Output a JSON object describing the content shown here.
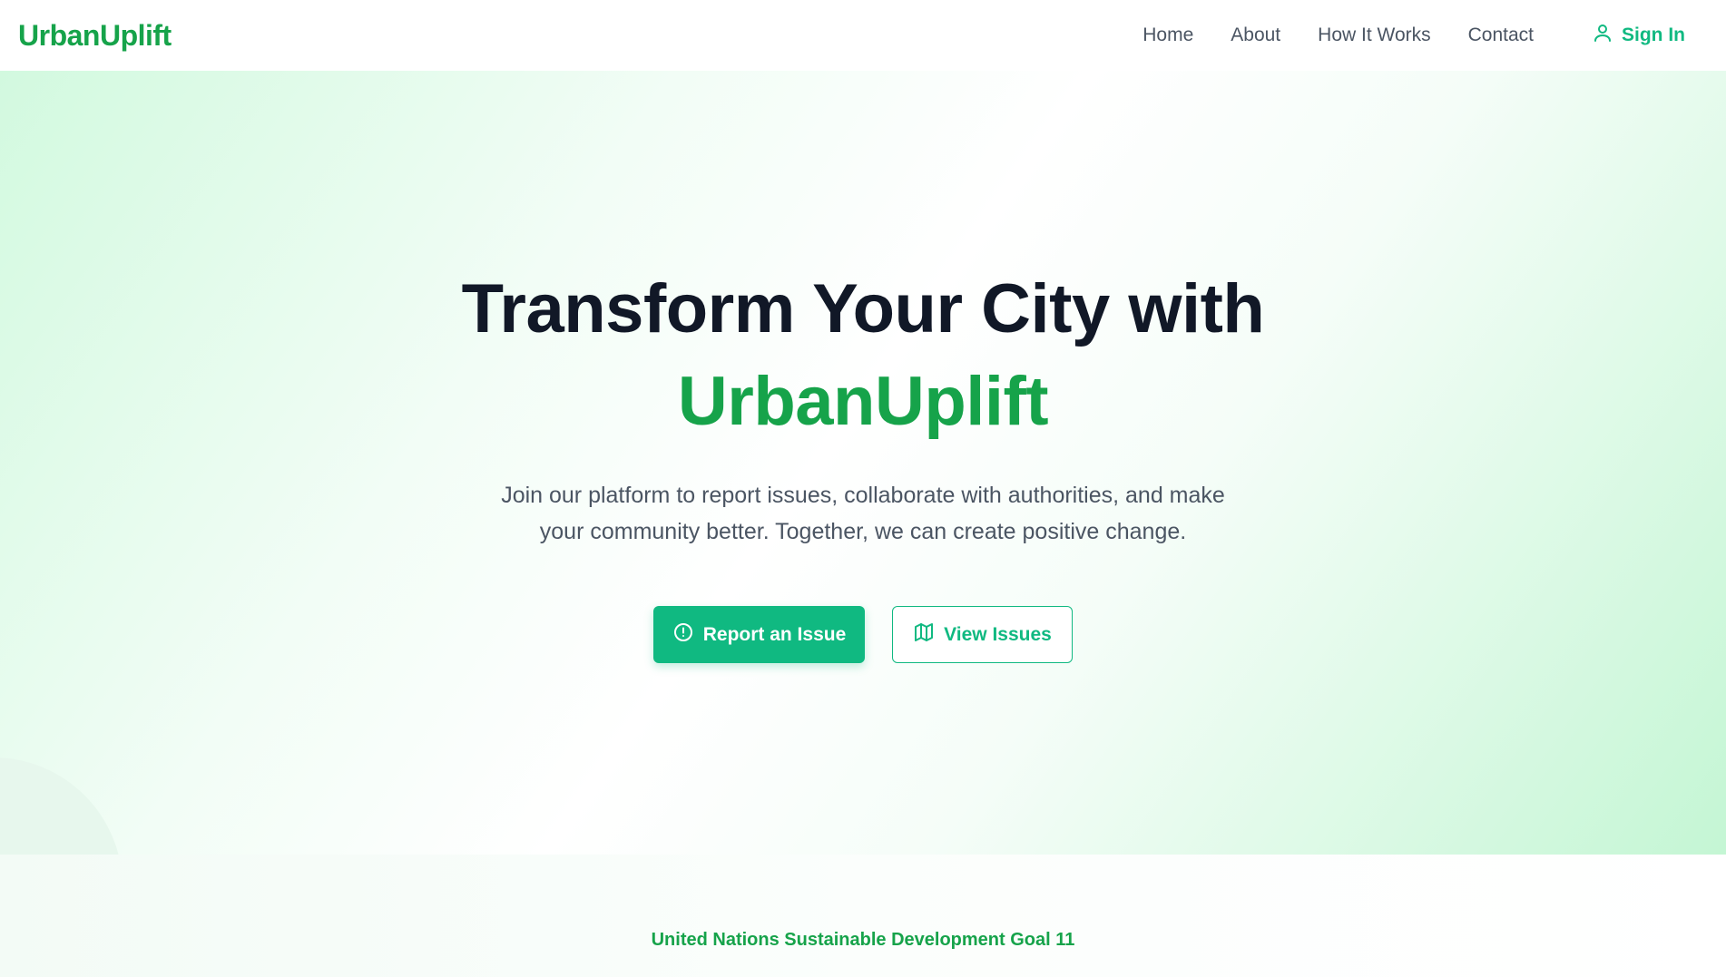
{
  "nav": {
    "logo": "UrbanUplift",
    "links": [
      "Home",
      "About",
      "How It Works",
      "Contact"
    ],
    "signin_label": "Sign In"
  },
  "hero": {
    "title_line1": "Transform Your City with",
    "title_accent": "UrbanUplift",
    "subtitle": "Join our platform to report issues, collaborate with authorities, and make your community better. Together, we can create positive change.",
    "primary_button": "Report an Issue",
    "secondary_button": "View Issues"
  },
  "sdg": {
    "label": "United Nations Sustainable Development Goal 11"
  },
  "icons": {
    "signin": "user-icon",
    "primary_button": "alert-circle-icon",
    "secondary_button": "map-icon"
  },
  "colors": {
    "brand_green": "#16a34a",
    "accent_emerald": "#10b981",
    "heading": "#111827",
    "body_text": "#4b5563"
  }
}
